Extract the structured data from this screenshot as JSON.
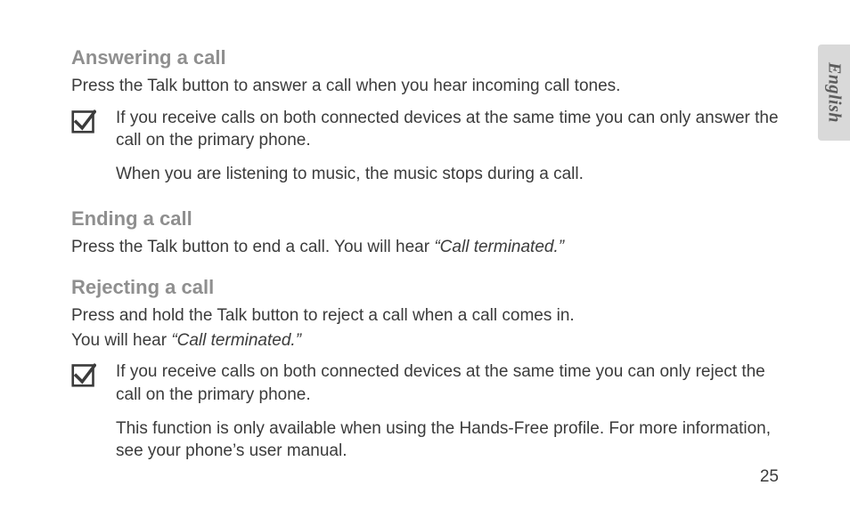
{
  "language_tab": "English",
  "page_number": "25",
  "sections": {
    "answering": {
      "heading": "Answering a call",
      "body": "Press the Talk button to answer a call when you hear incoming call tones.",
      "note1": "If you receive calls on both connected devices at the same time you can only answer the call on the primary phone.",
      "note2": "When you are listening to music, the music stops during a call."
    },
    "ending": {
      "heading": "Ending a call",
      "body_prefix": "Press the Talk button to end a call. You will hear ",
      "body_quote": "“Call terminated.”"
    },
    "rejecting": {
      "heading": "Rejecting a call",
      "body_line1": "Press and hold the Talk button to reject a call when a call comes in.",
      "body_line2_prefix": "You will hear ",
      "body_line2_quote": "“Call terminated.”",
      "note1": "If you receive calls on both connected devices at the same time you can only reject the call on the primary phone.",
      "note2": "This function is only available when using the Hands-Free profile. For more information, see your phone’s user manual."
    }
  }
}
